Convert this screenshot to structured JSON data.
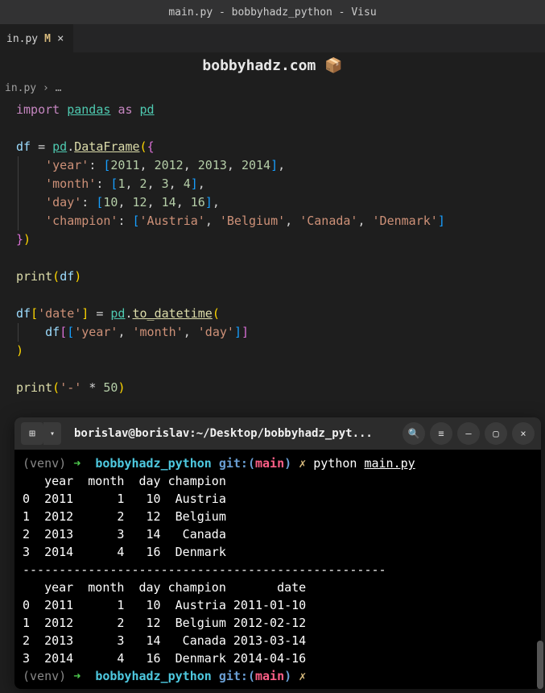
{
  "window": {
    "title": "main.py - bobbyhadz_python - Visu"
  },
  "tab": {
    "name": "in.py",
    "modified": "M"
  },
  "banner": {
    "text": "bobbyhadz.com 📦"
  },
  "breadcrumb": {
    "file": "in.py",
    "sep": "›",
    "more": "…"
  },
  "code": {
    "l1_import": "import",
    "l1_pandas": "pandas",
    "l1_as": "as",
    "l1_pd": "pd",
    "l3_df": "df",
    "l3_pd": "pd",
    "l3_DataFrame": "DataFrame",
    "l4_year": "'year'",
    "l4_v1": "2011",
    "l4_v2": "2012",
    "l4_v3": "2013",
    "l4_v4": "2014",
    "l5_month": "'month'",
    "l5_v1": "1",
    "l5_v2": "2",
    "l5_v3": "3",
    "l5_v4": "4",
    "l6_day": "'day'",
    "l6_v1": "10",
    "l6_v2": "12",
    "l6_v3": "14",
    "l6_v4": "16",
    "l7_champion": "'champion'",
    "l7_v1": "'Austria'",
    "l7_v2": "'Belgium'",
    "l7_v3": "'Canada'",
    "l7_v4": "'Denmark'",
    "print": "print",
    "df": "df",
    "l11_date": "'date'",
    "l11_pd": "pd",
    "l11_to_datetime": "to_datetime",
    "l12_year": "'year'",
    "l12_month": "'month'",
    "l12_day": "'day'",
    "l15_dash": "'-'",
    "l15_50": "50"
  },
  "terminal": {
    "titlebar": "borislav@borislav:~/Desktop/bobbyhadz_pyt...",
    "prompt": {
      "venv": "(venv)",
      "arrow": "➜",
      "dir": "bobbyhadz_python",
      "git": "git:(",
      "branch": "main",
      "git_close": ")",
      "dirty": "✗",
      "cmd": "python",
      "arg": "main.py"
    },
    "out": {
      "h1": "   year  month  day champion",
      "r1": "0  2011      1   10  Austria",
      "r2": "1  2012      2   12  Belgium",
      "r3": "2  2013      3   14   Canada",
      "r4": "3  2014      4   16  Denmark",
      "sep": "--------------------------------------------------",
      "h2": "   year  month  day champion       date",
      "r5": "0  2011      1   10  Austria 2011-01-10",
      "r6": "1  2012      2   12  Belgium 2012-02-12",
      "r7": "2  2013      3   14   Canada 2013-03-14",
      "r8": "3  2014      4   16  Denmark 2014-04-16"
    }
  },
  "chart_data": {
    "type": "table",
    "title": "DataFrame output",
    "tables": [
      {
        "columns": [
          "year",
          "month",
          "day",
          "champion"
        ],
        "rows": [
          [
            2011,
            1,
            10,
            "Austria"
          ],
          [
            2012,
            2,
            12,
            "Belgium"
          ],
          [
            2013,
            3,
            14,
            "Canada"
          ],
          [
            2014,
            4,
            16,
            "Denmark"
          ]
        ]
      },
      {
        "columns": [
          "year",
          "month",
          "day",
          "champion",
          "date"
        ],
        "rows": [
          [
            2011,
            1,
            10,
            "Austria",
            "2011-01-10"
          ],
          [
            2012,
            2,
            12,
            "Belgium",
            "2012-02-12"
          ],
          [
            2013,
            3,
            14,
            "Canada",
            "2013-03-14"
          ],
          [
            2014,
            4,
            16,
            "Denmark",
            "2014-04-16"
          ]
        ]
      }
    ]
  }
}
